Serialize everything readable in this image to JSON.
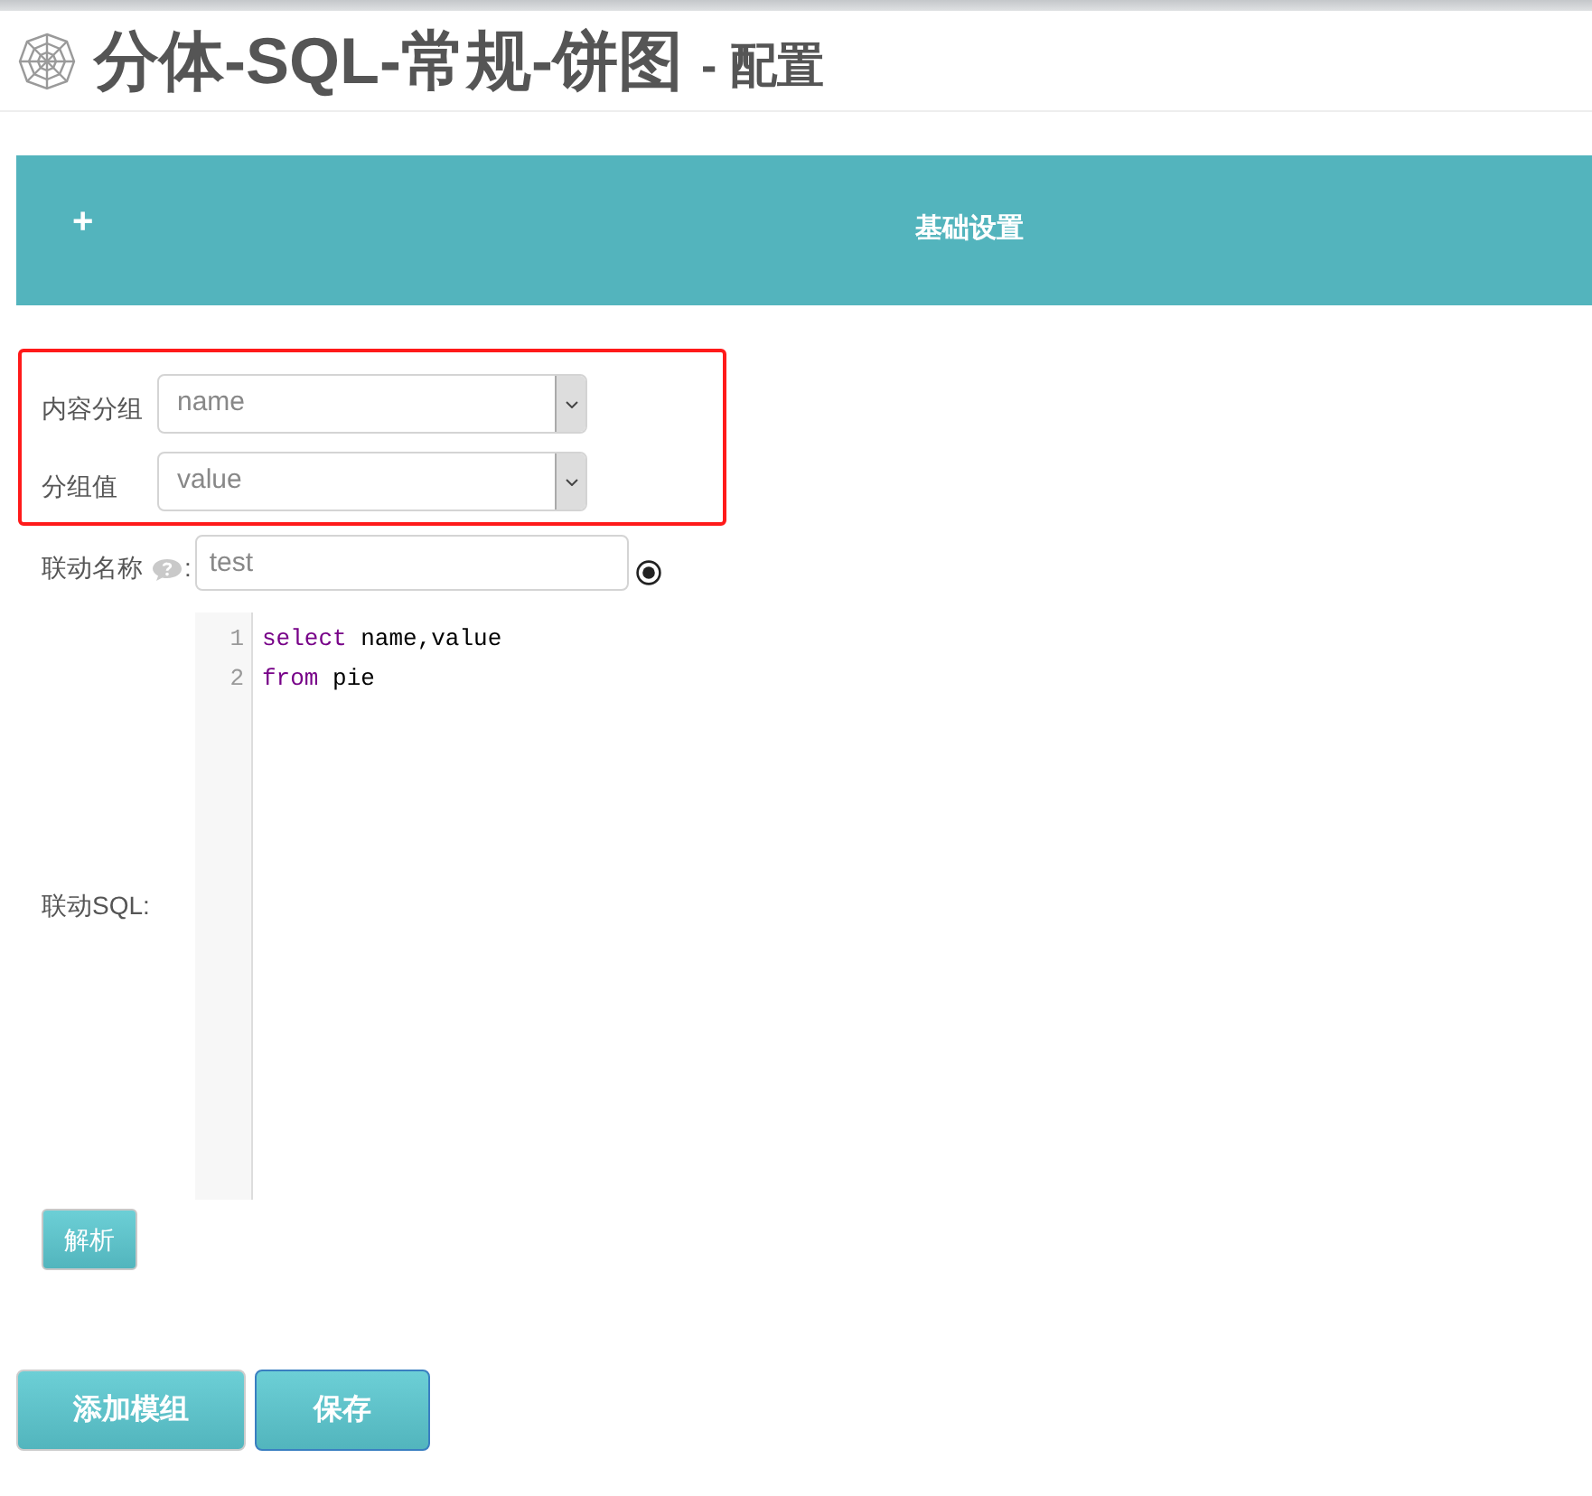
{
  "header": {
    "title": "分体-SQL-常规-饼图",
    "suffix": "- 配置"
  },
  "section": {
    "toggle": "+",
    "title": "基础设置"
  },
  "groups": [
    {
      "highlighted": true,
      "fields": [
        {
          "kind": "select",
          "label": "内容分组",
          "value": "name"
        },
        {
          "kind": "select",
          "label": "分组值",
          "value": "value"
        }
      ]
    },
    {
      "highlighted": false,
      "fields": [
        {
          "kind": "text",
          "label": "联动名称",
          "help": true,
          "colon": ":",
          "value": "test",
          "radio_selected": true
        },
        {
          "kind": "code",
          "label": "联动SQL:",
          "lines": [
            {
              "number": "1",
              "tokens": [
                {
                  "kind": "keyword",
                  "text": "select"
                },
                {
                  "kind": "plain",
                  "text": "name,value"
                }
              ]
            },
            {
              "number": "2",
              "tokens": [
                {
                  "kind": "keyword",
                  "text": "from"
                },
                {
                  "kind": "plain",
                  "text": "pie"
                }
              ]
            }
          ]
        }
      ]
    }
  ],
  "parse_button": {
    "label": "解析"
  },
  "buttons": [
    {
      "label": "添加模组",
      "focused": false
    },
    {
      "label": "保存",
      "focused": true
    }
  ]
}
